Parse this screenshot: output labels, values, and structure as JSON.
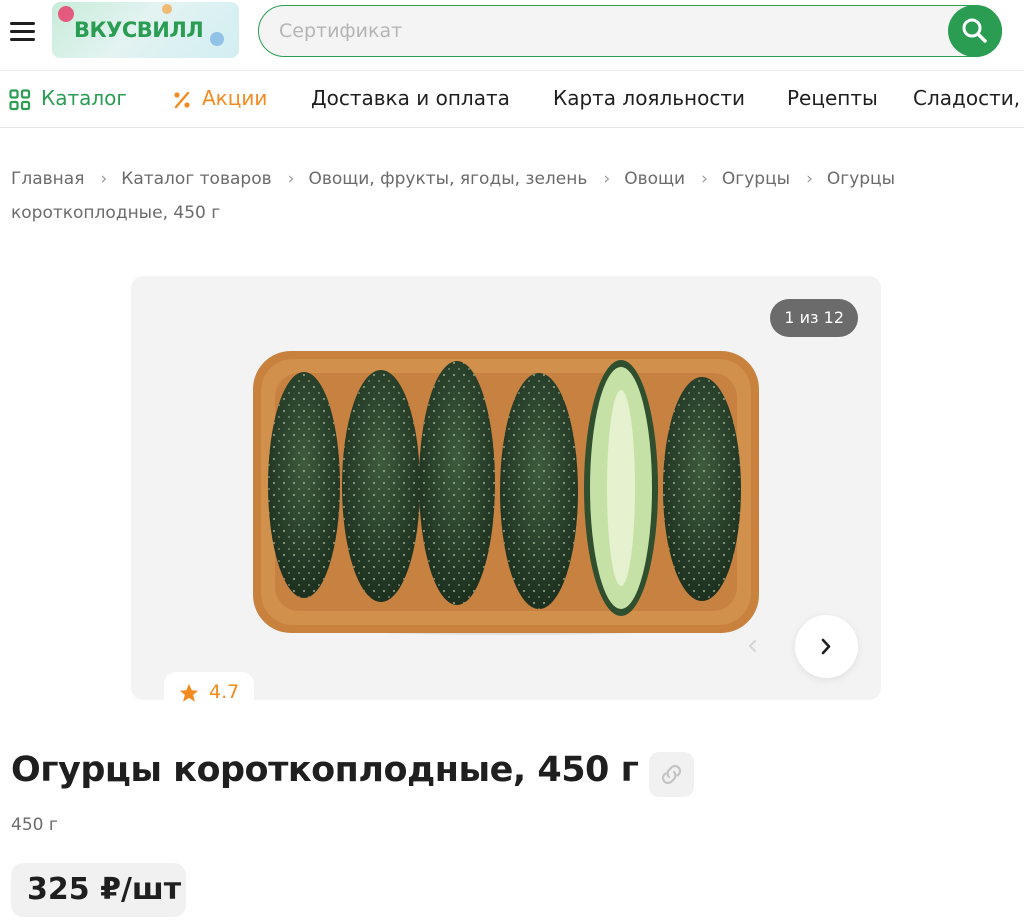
{
  "header": {
    "logo_text": "ВКУСВИЛЛ",
    "search": {
      "placeholder": "Сертификат",
      "value": ""
    },
    "icons": {
      "menu": "hamburger-icon",
      "search": "search-icon"
    }
  },
  "nav": {
    "items": [
      {
        "label": "Каталог",
        "icon": "grid-icon",
        "color": "#2a9d53"
      },
      {
        "label": "Акции",
        "icon": "percent-icon",
        "color": "#f28a1e"
      },
      {
        "label": "Доставка и оплата"
      },
      {
        "label": "Карта лояльности"
      },
      {
        "label": "Рецепты"
      },
      {
        "label": "Сладости,"
      }
    ]
  },
  "breadcrumbs": [
    "Главная",
    "Каталог товаров",
    "Овощи, фрукты, ягоды, зелень",
    "Овощи",
    "Огурцы",
    "Огурцы короткоплодные, 450 г"
  ],
  "gallery": {
    "counter": "1 из 12",
    "image_alt": "Огурцы короткоплодные в лотке",
    "rating": "4.7"
  },
  "product": {
    "title": "Огурцы короткоплодные, 450 г",
    "weight": "450 г",
    "price": "325 ₽/шт"
  },
  "colors": {
    "brand_green": "#2a9d53",
    "accent_orange": "#f28a1e",
    "text_dark": "#1f1f1f",
    "text_muted": "#6b6b6b"
  }
}
